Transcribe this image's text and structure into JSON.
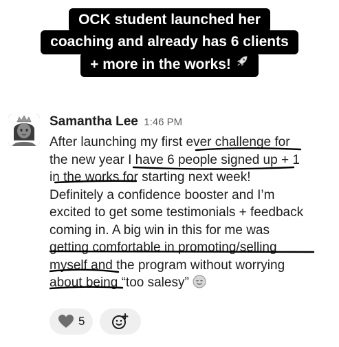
{
  "headline": {
    "lines": [
      "OCK student launched her",
      "coaching and already has 6 clients",
      "+ more in the works!"
    ],
    "emoji_icon": "rocket-icon"
  },
  "message": {
    "sender": "Samantha Lee",
    "timestamp": "1:46 PM",
    "avatar_icon": "princess-avatar",
    "text_lines": [
      "After launching my first ever challenge for",
      "the new year I have 6 people signed up + 1",
      "in the works for starting next week!",
      "Definitely a confidence booster and I’m",
      "excited to get some testimonials + feedback",
      "coming in. A big win in this for me was",
      "getting comfortable in promoting/selling",
      "myself and the program without worrying",
      "about being “too salesy”"
    ],
    "end_emoji_icon": "relieved-face-icon"
  },
  "reactions": [
    {
      "icon": "heart-icon",
      "count": "5"
    },
    {
      "icon": "add-reaction-icon"
    }
  ],
  "colors": {
    "headline_bg": "#000000",
    "headline_text": "#ffffff",
    "reaction_bg": "#efefef",
    "timestamp": "#616061"
  }
}
